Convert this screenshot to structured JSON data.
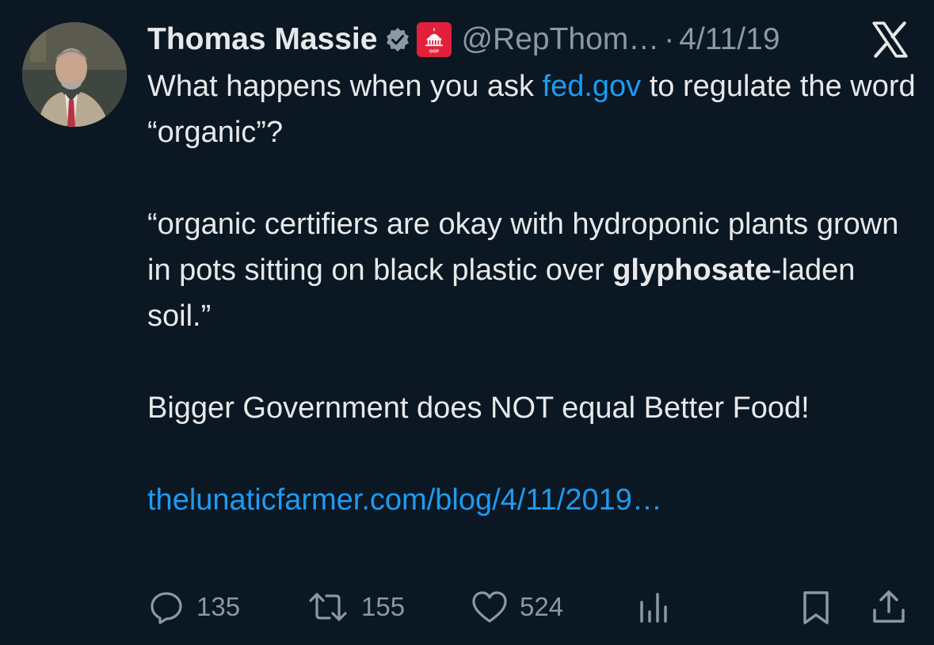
{
  "author": {
    "name": "Thomas Massie",
    "handle": "@RepThom…",
    "date": "4/11/19",
    "separator": "·",
    "badge_label": "GOP"
  },
  "tweet": {
    "line1_pre": "What happens when you ask ",
    "line1_link": "fed.gov",
    "line1_post": " to regulate the word “organic”?",
    "quote_pre": "“organic certifiers are okay with hydroponic plants grown in pots sitting on black plastic over ",
    "quote_bold": "glyphosate",
    "quote_post": "-laden soil.”",
    "closing": "Bigger Government does NOT equal Better Food!",
    "url": "thelunaticfarmer.com/blog/4/11/2019…"
  },
  "actions": {
    "replies": "135",
    "retweets": "155",
    "likes": "524"
  },
  "icons": {
    "verified": "verified-badge-icon",
    "government": "capitol-icon",
    "platform": "x-logo-icon",
    "reply": "reply-icon",
    "retweet": "retweet-icon",
    "like": "heart-icon",
    "views": "views-icon",
    "bookmark": "bookmark-icon",
    "share": "share-icon"
  },
  "colors": {
    "background": "#0b1723",
    "text": "#e7e9ea",
    "secondary": "#8b98a5",
    "link": "#1d9bf0",
    "gov_badge": "#e2203a",
    "verified": "#8b98a5"
  }
}
